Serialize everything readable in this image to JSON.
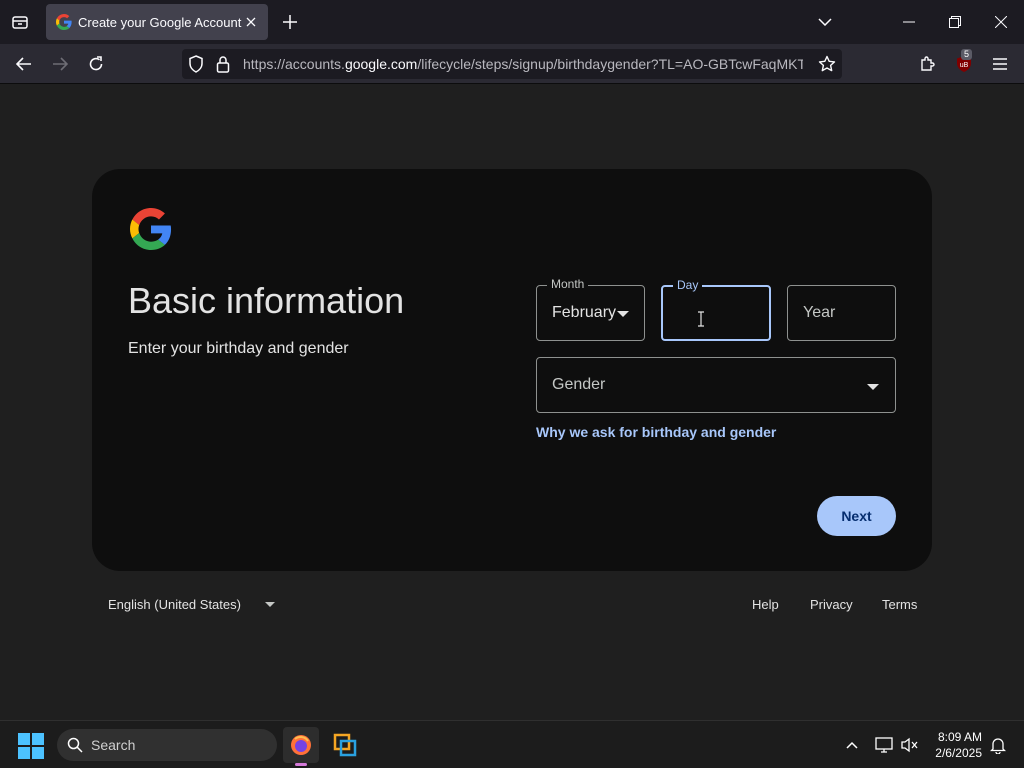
{
  "browser": {
    "tab_title": "Create your Google Account",
    "url_prefix": "https://accounts.",
    "url_host": "google.com",
    "url_path": "/lifecycle/steps/signup/birthdaygender?TL=AO-GBTcwFaqMKTC",
    "extension_badge": "5"
  },
  "page": {
    "heading": "Basic information",
    "subtext": "Enter your birthday and gender",
    "month": {
      "label": "Month",
      "value": "February"
    },
    "day": {
      "label": "Day",
      "value": ""
    },
    "year": {
      "placeholder": "Year"
    },
    "gender": {
      "placeholder": "Gender"
    },
    "why_link": "Why we ask for birthday and gender",
    "next_button": "Next"
  },
  "footer": {
    "language": "English (United States)",
    "links": [
      "Help",
      "Privacy",
      "Terms"
    ]
  },
  "taskbar": {
    "search_label": "Search",
    "time": "8:09 AM",
    "date": "2/6/2025"
  },
  "colors": {
    "accent": "#a8c7fa",
    "page_bg": "#1f1f1f",
    "card_bg": "#0e0e0e"
  }
}
